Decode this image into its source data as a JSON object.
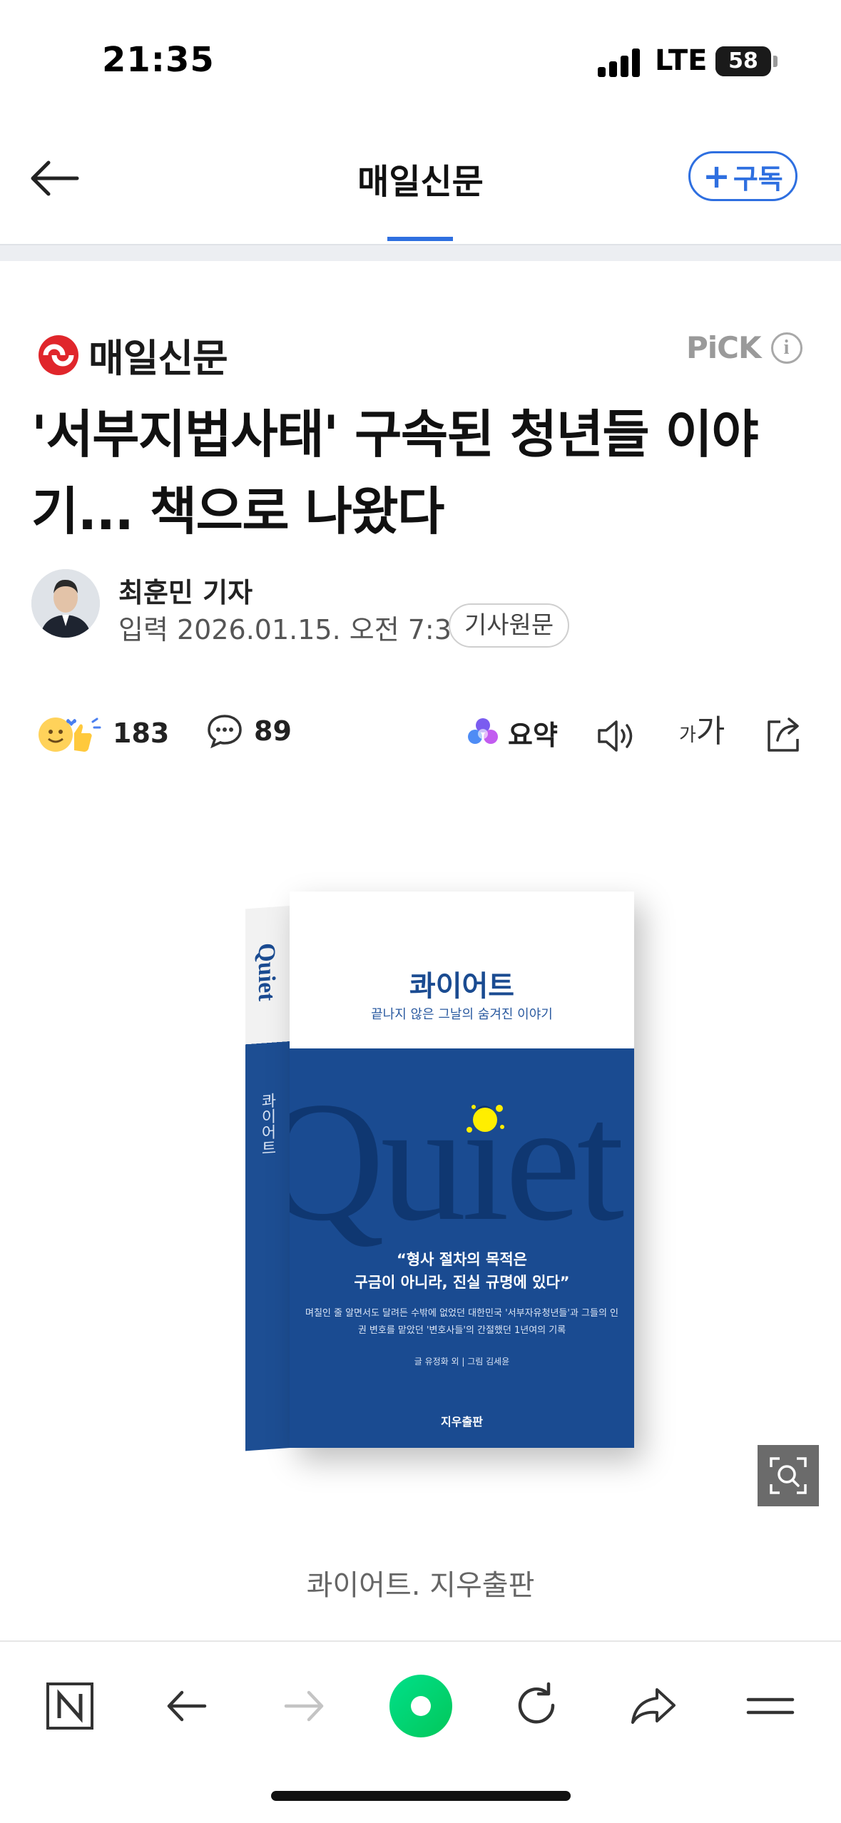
{
  "status_bar": {
    "time": "21:35",
    "network": "LTE",
    "battery": "58",
    "battery_level": 0.58
  },
  "nav": {
    "title": "매일신문",
    "subscribe_label": "구독",
    "back_icon": "arrow-left-icon"
  },
  "article": {
    "press": "매일신문",
    "pick": "PiCK",
    "headline": "'서부지법사태' 구속된 청년들 이야기... 책으로 나왔다",
    "reporter": "최훈민 기자",
    "date_line": "입력 2026.01.15. 오전 7:31",
    "original_label": "기사원문"
  },
  "actions": {
    "reaction_count": "183",
    "comment_count": "89",
    "summary_label": "요약",
    "font_small": "가",
    "font_large": "가"
  },
  "image": {
    "cover_title": "콰이어트",
    "cover_subtitle": "끝나지 않은 그날의 숨겨진 이야기",
    "cover_word": "Quiet",
    "cover_quote_1": "“형사 절차의 목적은",
    "cover_quote_2": "구금이 아니라, 진실 규명에 있다”",
    "cover_desc": "며칠인 줄 알면서도 달려든 수밖에 없었던 대한민국 '서부자유청년들'과 그들의 인권 변호를 맡았던 '변호사들'의 간절했던 1년여의 기록",
    "cover_credit": "글 유정화 외 | 그림 김세윤",
    "cover_publisher": "지우출판",
    "spine_title": "콰이어트",
    "caption": "콰이어트. 지우출판"
  },
  "colors": {
    "accent": "#2e6fe0",
    "press_red": "#e0262b",
    "cover_blue": "#1a4b91",
    "naver_green": "#03d86f"
  }
}
